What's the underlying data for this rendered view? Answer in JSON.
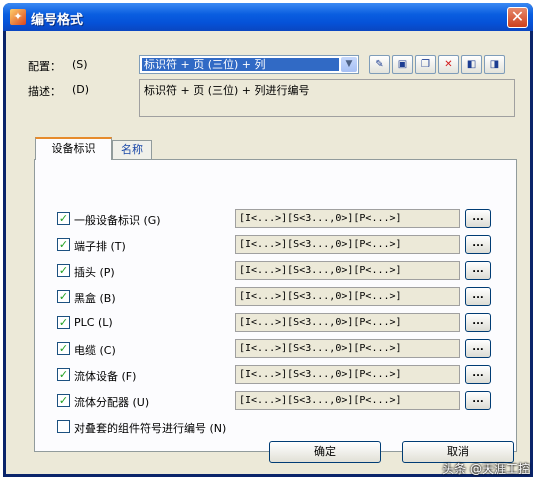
{
  "window": {
    "title": "编号格式",
    "close_symbol": "✕"
  },
  "config": {
    "label": "配置：",
    "shortcut": "(S)",
    "value": "标识符 + 页 (三位) + 列",
    "toolbar": [
      "new-icon",
      "save-icon",
      "copy-icon",
      "delete-icon",
      "import-icon",
      "export-icon"
    ]
  },
  "description": {
    "label": "描述：",
    "shortcut": "(D)",
    "value": "标识符 + 页 (三位) + 列进行编号"
  },
  "tabs": [
    {
      "label": "设备标识",
      "active": true
    },
    {
      "label": "名称",
      "active": false
    }
  ],
  "rows": [
    {
      "label": "一般设备标识 (G)",
      "checked": true,
      "format": "[I<...>][S<3...,0>][P<...>]",
      "browse": "..."
    },
    {
      "label": "端子排 (T)",
      "checked": true,
      "format": "[I<...>][S<3...,0>][P<...>]",
      "browse": "..."
    },
    {
      "label": "插头 (P)",
      "checked": true,
      "format": "[I<...>][S<3...,0>][P<...>]",
      "browse": "..."
    },
    {
      "label": "黑盒 (B)",
      "checked": true,
      "format": "[I<...>][S<3...,0>][P<...>]",
      "browse": "..."
    },
    {
      "label": "PLC (L)",
      "checked": true,
      "format": "[I<...>][S<3...,0>][P<...>]",
      "browse": "..."
    },
    {
      "label": "电缆 (C)",
      "checked": true,
      "format": "[I<...>][S<3...,0>][P<...>]",
      "browse": "..."
    },
    {
      "label": "流体设备 (F)",
      "checked": true,
      "format": "[I<...>][S<3...,0>][P<...>]",
      "browse": "..."
    },
    {
      "label": "流体分配器 (U)",
      "checked": true,
      "format": "[I<...>][S<3...,0>][P<...>]",
      "browse": "..."
    }
  ],
  "nested": {
    "label": "对叠套的组件符号进行编号 (N)",
    "checked": false
  },
  "buttons": {
    "ok": "确定",
    "cancel": "取消"
  },
  "watermark": "头条 @天涯工控",
  "colors": {
    "title_bar": "#0a5ee0",
    "selection": "#316ac5",
    "tab_accent": "#e68b2c",
    "check": "#21a121"
  }
}
